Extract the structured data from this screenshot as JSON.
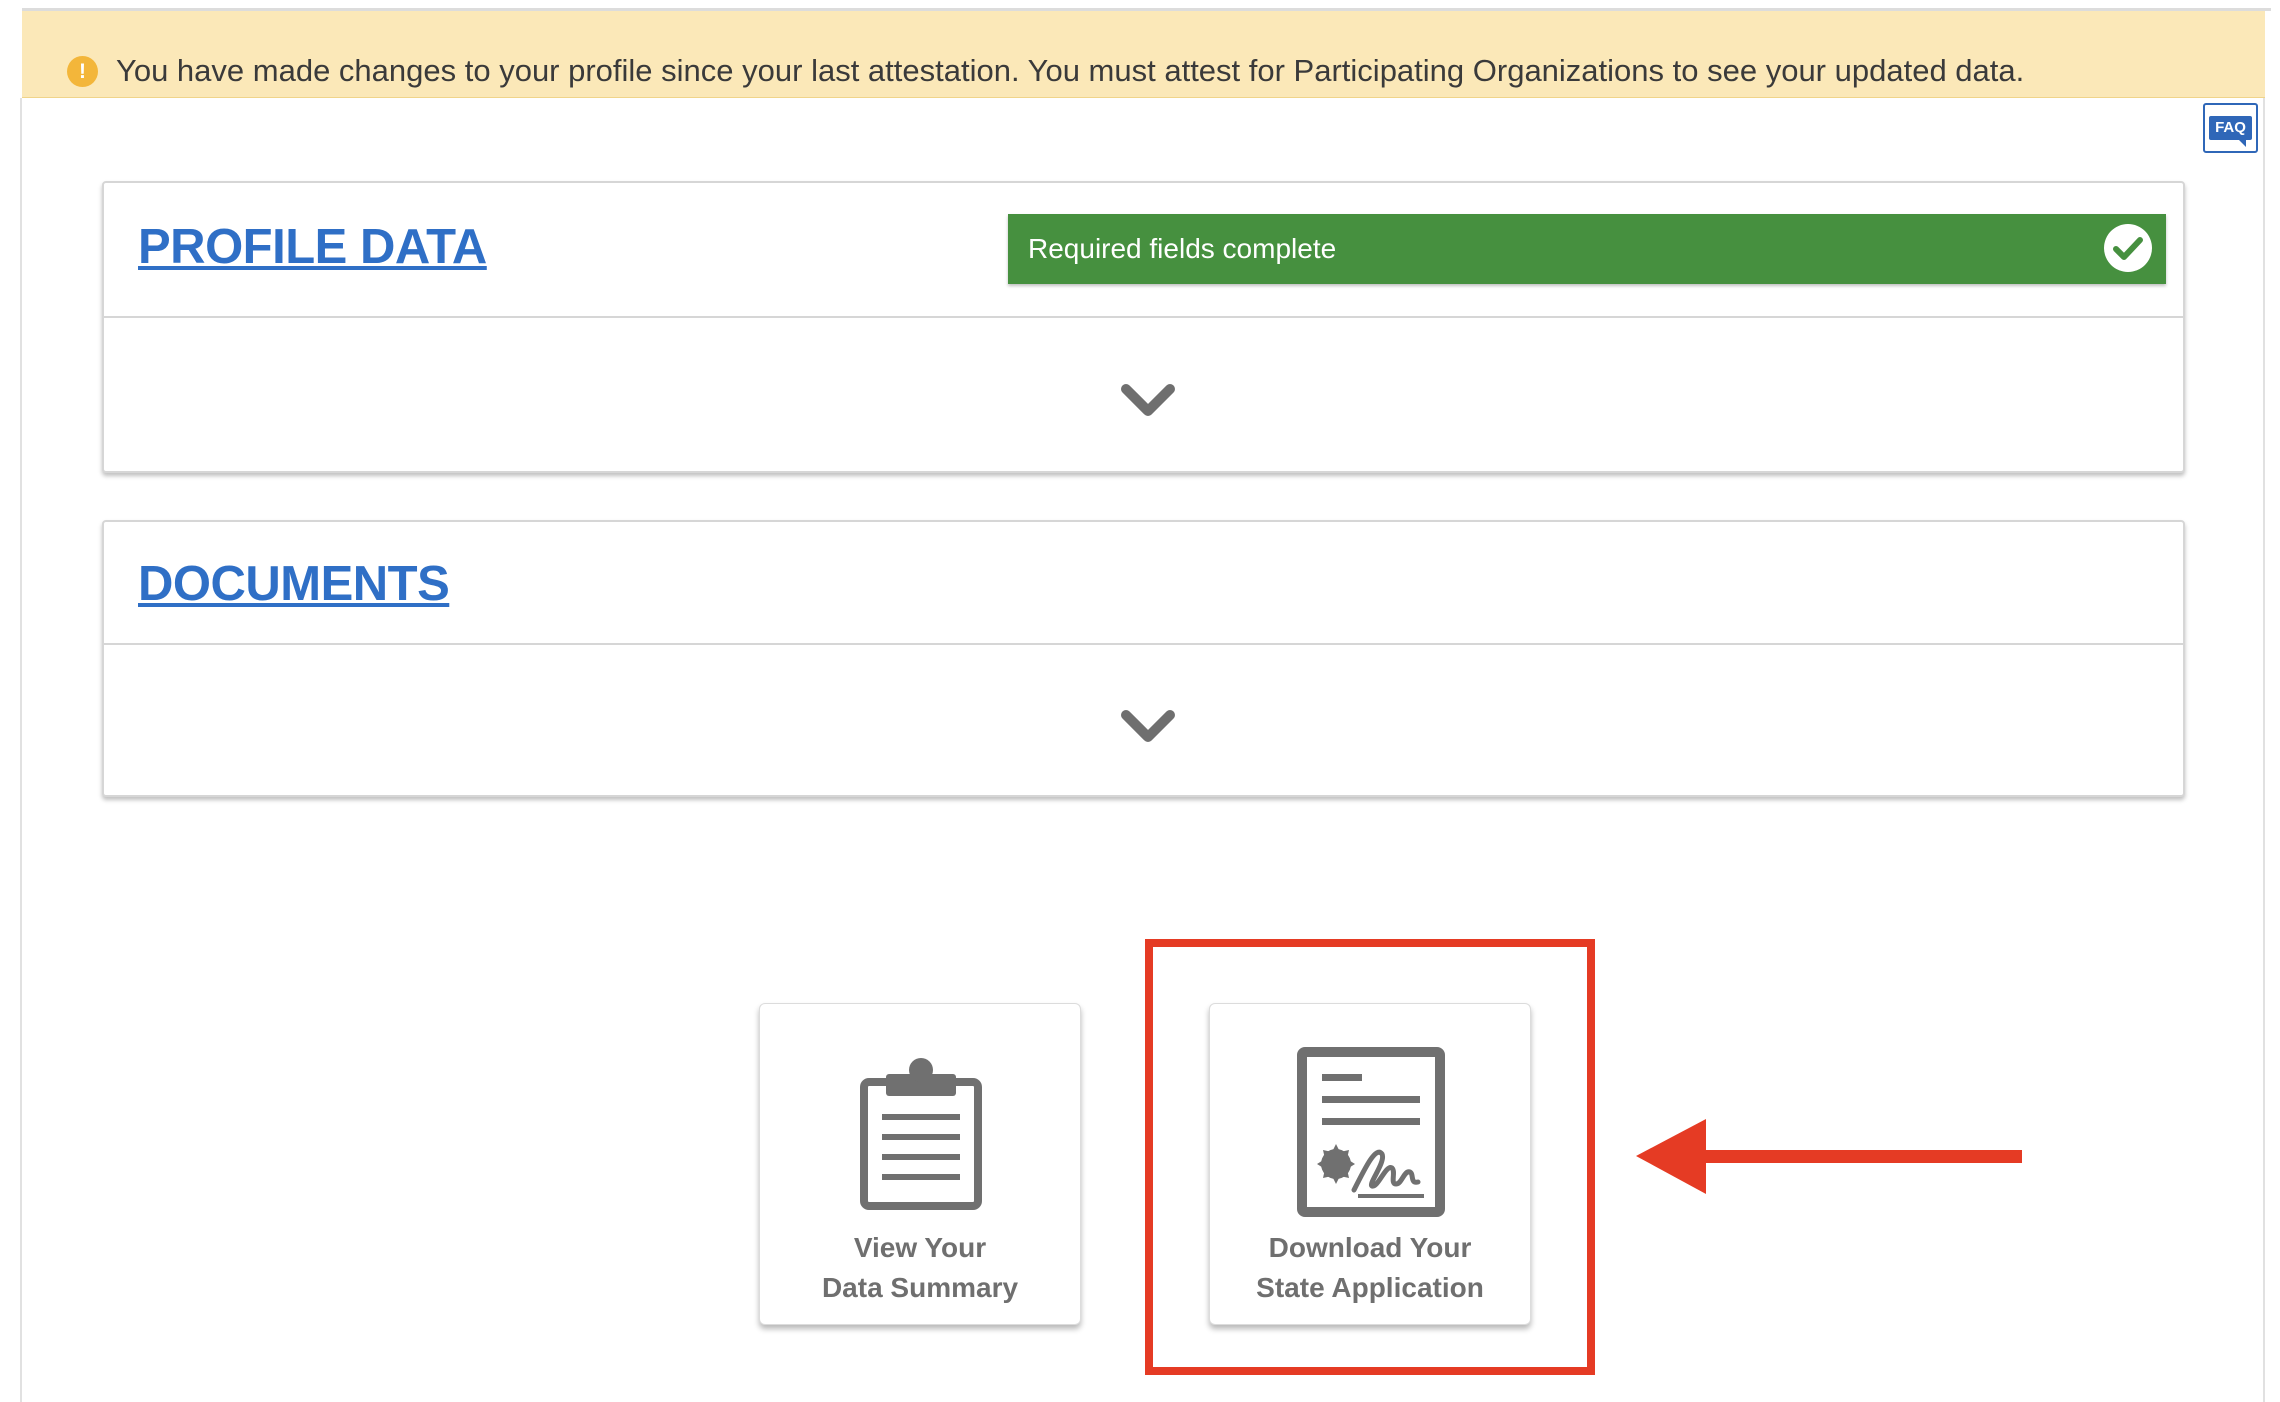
{
  "alert": {
    "icon": "exclamation-circle-icon",
    "message": "You have made changes to your profile since your last attestation. You must attest for Participating Organizations to see your updated data.",
    "color": "#fbe8b8"
  },
  "faq": {
    "label": "FAQ",
    "color": "#2f67b8"
  },
  "profile_panel": {
    "title": "PROFILE DATA",
    "status": {
      "text": "Required fields complete",
      "icon": "checkmark-circle-icon",
      "color": "#46903f"
    },
    "expand_icon": "chevron-down-icon"
  },
  "documents_panel": {
    "title": "DOCUMENTS",
    "expand_icon": "chevron-down-icon"
  },
  "tiles": [
    {
      "icon": "clipboard-icon",
      "line1": "View Your",
      "line2": "Data Summary"
    },
    {
      "icon": "certificate-document-icon",
      "line1": "Download Your",
      "line2": "State Application"
    }
  ],
  "annotation": {
    "highlight_color": "#e53b24",
    "arrow_icon": "arrow-left-icon"
  }
}
